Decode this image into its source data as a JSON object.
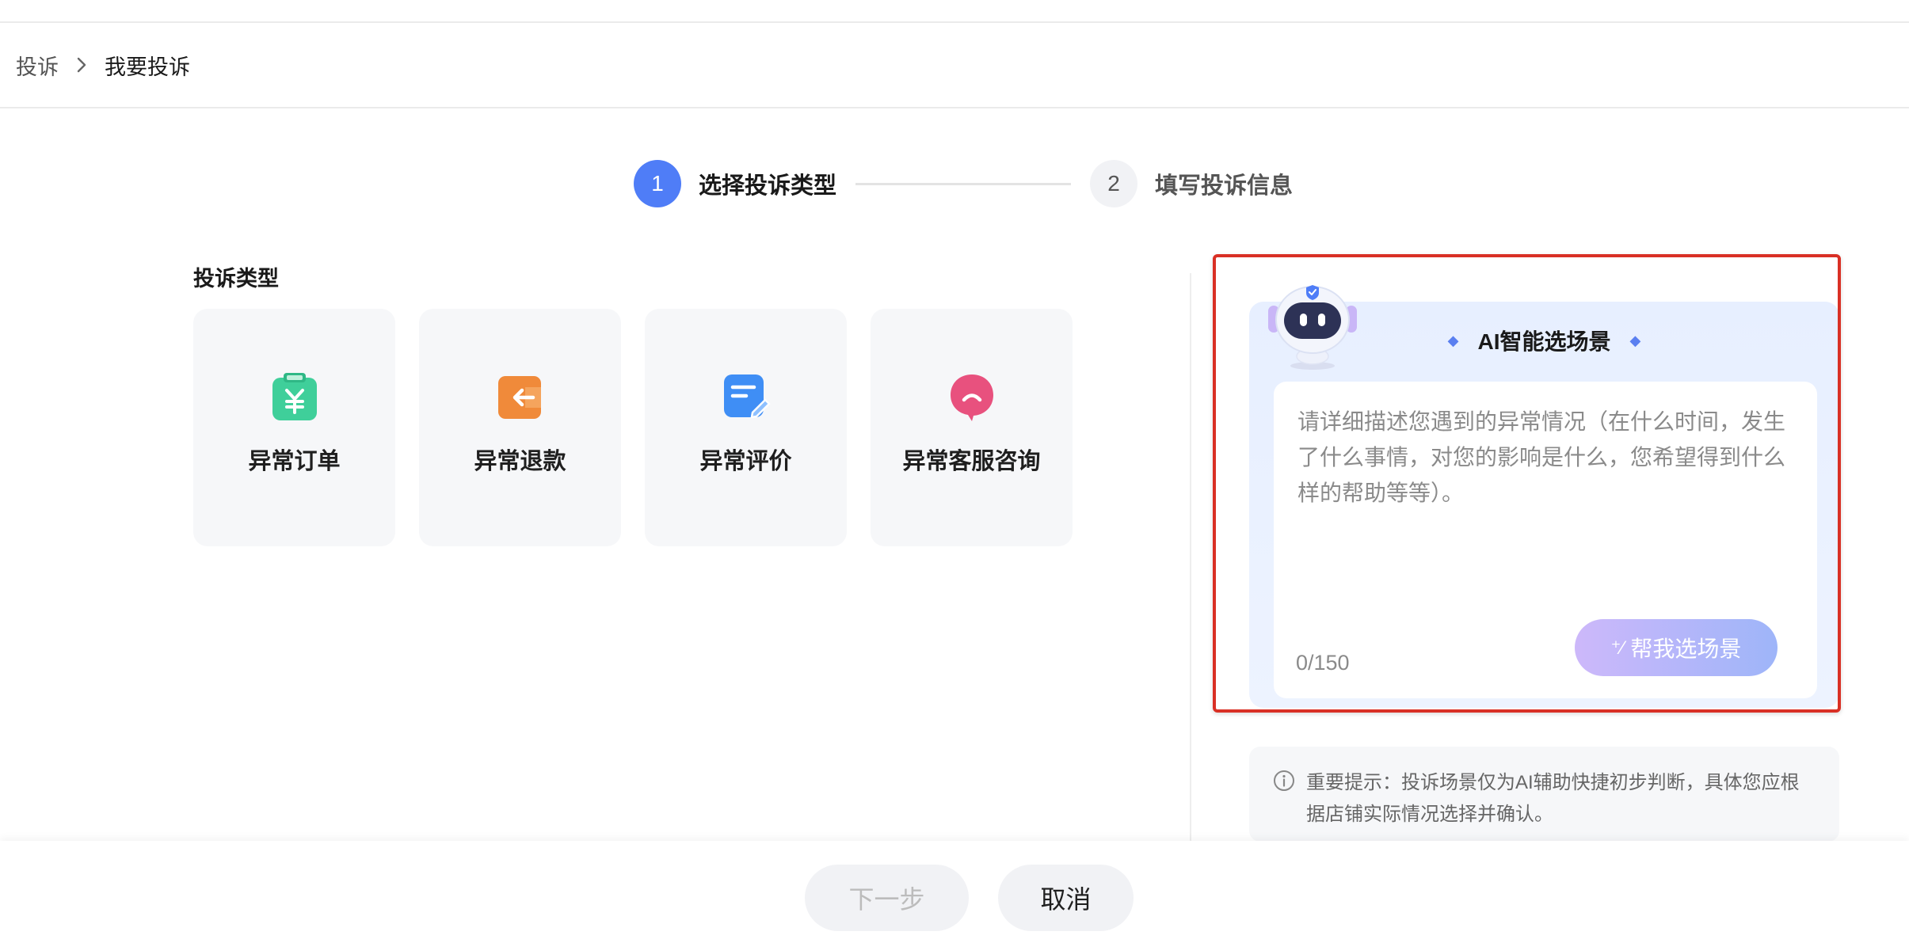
{
  "breadcrumb": {
    "parent": "投诉",
    "current": "我要投诉"
  },
  "steps": [
    {
      "number": "1",
      "label": "选择投诉类型",
      "state": "active"
    },
    {
      "number": "2",
      "label": "填写投诉信息",
      "state": "inactive"
    }
  ],
  "complaint_types": {
    "title": "投诉类型",
    "items": [
      {
        "label": "异常订单",
        "icon": "yuan-clipboard-icon",
        "color": "#3fcf9a"
      },
      {
        "label": "异常退款",
        "icon": "refund-arrow-icon",
        "color": "#f08a3a"
      },
      {
        "label": "异常评价",
        "icon": "edit-note-icon",
        "color": "#3f8ef5"
      },
      {
        "label": "异常客服咨询",
        "icon": "chat-bubble-icon",
        "color": "#e8517e"
      }
    ]
  },
  "ai_panel": {
    "title": "AI智能选场景",
    "placeholder": "请详细描述您遇到的异常情况（在什么时间，发生了什么事情，对您的影响是什么，您希望得到什么样的帮助等等）。",
    "counter": "0/150",
    "help_button": "帮我选场景",
    "highlight_color": "#d93025"
  },
  "notice": {
    "text": "重要提示：投诉场景仅为AI辅助快捷初步判断，具体您应根据店铺实际情况选择并确认。"
  },
  "footer": {
    "next_label": "下一步",
    "cancel_label": "取消"
  },
  "colors": {
    "primary": "#4f7df7"
  }
}
